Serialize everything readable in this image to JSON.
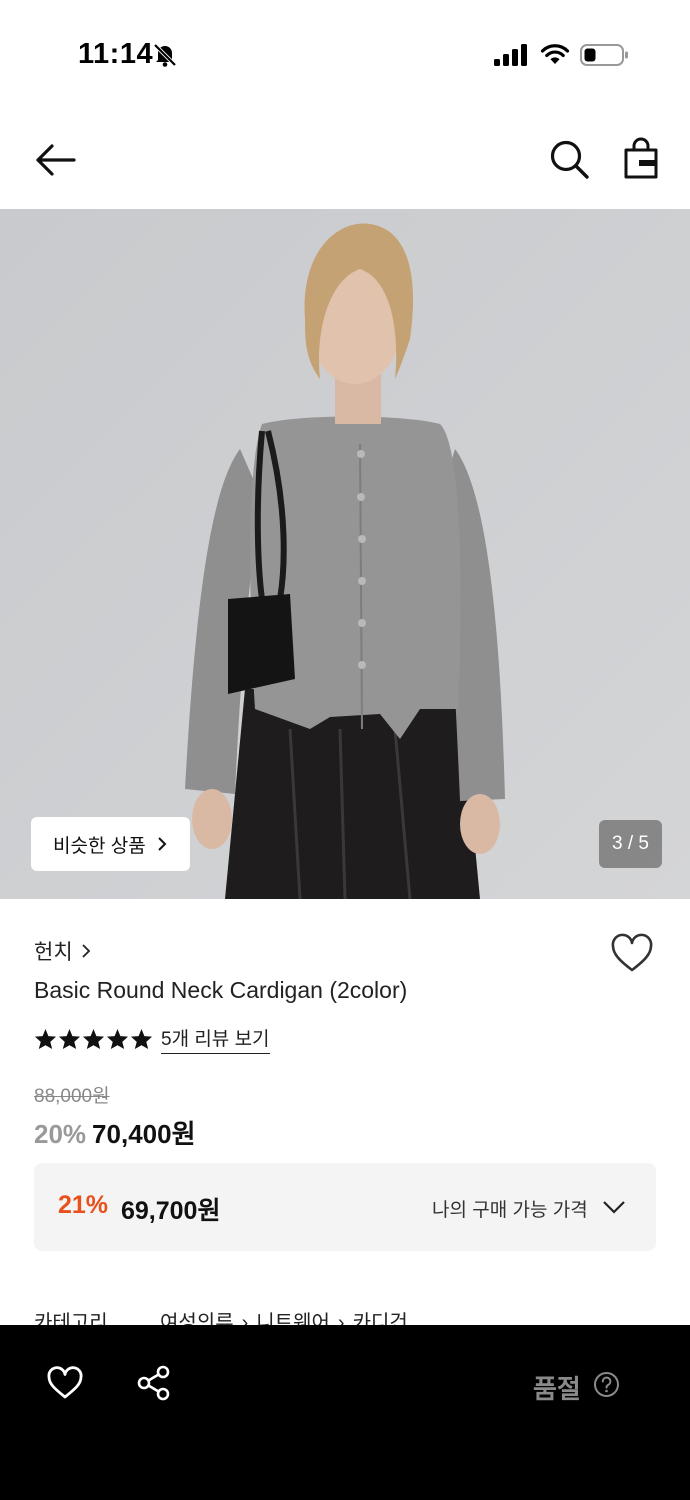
{
  "status_bar": {
    "time": "11:14"
  },
  "icons": {
    "bell": "bell-slash-icon",
    "signal": "cellular-signal-icon",
    "wifi": "wifi-icon",
    "battery": "battery-icon",
    "back": "arrow-left-icon",
    "search": "search-icon",
    "bag": "shopping-bag-icon",
    "heart": "heart-icon",
    "share": "share-icon",
    "help": "question-circle-icon"
  },
  "gallery": {
    "similar_label": "비슷한 상품",
    "page_indicator": "3 / 5"
  },
  "product": {
    "brand": "헌치",
    "name": "Basic Round Neck Cardigan (2color)",
    "rating_stars": 5,
    "review_link": "5개 리뷰 보기",
    "original_price": "88,000원",
    "discount_rate": "20%",
    "sale_price": "70,400원"
  },
  "my_price": {
    "discount_rate": "21%",
    "amount": "69,700원",
    "label": "나의 구매 가능 가격"
  },
  "category": {
    "label": "카테고리",
    "path": [
      "여성의류",
      "니트웨어",
      "카디건"
    ]
  },
  "bottom_bar": {
    "status": "품절"
  },
  "colors": {
    "accent_discount": "#e8501c",
    "bottom_bar_bg": "#000000"
  }
}
